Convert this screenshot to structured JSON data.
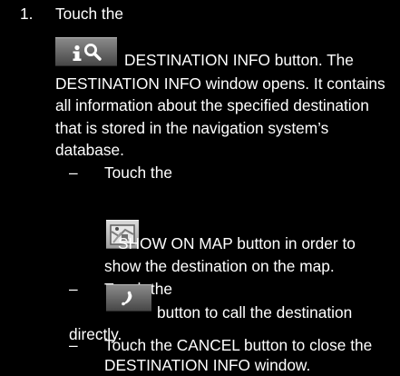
{
  "step": {
    "number": "1.",
    "line1": "Touch the",
    "after_info_button": "DESTINATION INFO button. The",
    "line3": "DESTINATION INFO window opens. It contains",
    "line4": "all information about the specified destination",
    "line5": "that is stored in the navigation system’s",
    "line6": "database."
  },
  "substeps": {
    "dash": "–",
    "map_intro": "Touch the",
    "map_after_button": "SHOW ON MAP button in order to",
    "map_cont": "show the destination on the map.",
    "call_intro": "Touch the",
    "call_after_button": "button to call the destination",
    "call_cont": "directly.",
    "cancel_line1": "Touch the CANCEL button to close the",
    "cancel_line2": "DESTINATION INFO window."
  },
  "icons": {
    "info_button": "info-magnifier-icon",
    "map_button": "map-icon",
    "call_button": "phone-icon"
  },
  "colors": {
    "background": "#000000",
    "text": "#ffffff",
    "button_gray": "#6c6c6c"
  }
}
